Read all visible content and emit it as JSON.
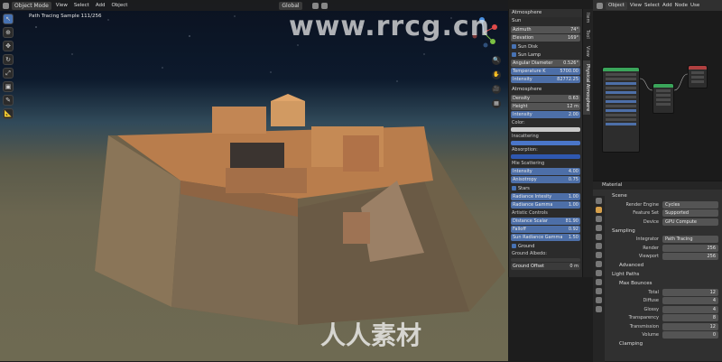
{
  "viewport": {
    "mode": "Object Mode",
    "menus": [
      "View",
      "Select",
      "Add",
      "Object"
    ],
    "orientation": "Global",
    "status": "Path Tracing Sample 111/256",
    "watermark": "www.rrcg.cn",
    "watermark_logo": "人人素材"
  },
  "atmosphere": {
    "title": "Atmosphere",
    "sun_section": "Sun",
    "azimuth_label": "Azimuth",
    "azimuth_value": "74°",
    "elevation_label": "Elevation",
    "elevation_value": "169°",
    "sun_disk": "Sun Disk",
    "sun_lamp": "Sun Lamp",
    "angular_label": "Angular Diameter",
    "angular_value": "0.526°",
    "temp_label": "Temperature K",
    "temp_value": "5700.00",
    "intensity_label": "Intensity",
    "intensity_value": "82772.25",
    "atmo_section": "Atmosphere",
    "density_label": "Density",
    "density_value": "0.63",
    "height_label": "Height",
    "height_value": "12 m",
    "a_intensity_label": "Intensity",
    "a_intensity_value": "2.00",
    "color_label": "Color:",
    "inscattering_label": "Inscattering",
    "absorption_label": "Absorption:",
    "mie_label": "Mie Scattering",
    "mie_intensity_label": "Intensity",
    "mie_intensity_value": "4.00",
    "anisotropy_label": "Anisotropy",
    "anisotropy_value": "0.75",
    "stars_section": "Stars",
    "rad_int_label": "Radiance Intesity",
    "rad_int_value": "1.00",
    "rad_gamma_label": "Radiance Gamma",
    "rad_gamma_value": "1.00",
    "artistic_label": "Artistic Controls",
    "dist_scalar_label": "Distance Scalar",
    "dist_scalar_value": "81.90",
    "falloff_label": "Falloff",
    "falloff_value": "0.92",
    "sun_rad_gamma_label": "Sun Radiance Gamma",
    "sun_rad_gamma_value": "1.50",
    "ground_section": "Ground",
    "ground_albedo_label": "Ground Albedo:",
    "ground_offset_label": "Ground Offset",
    "ground_offset_value": "0 m"
  },
  "side_tabs": [
    "Item",
    "Tool",
    "View",
    "Physical Atmosphere"
  ],
  "node_header": {
    "mode": "Object",
    "menus": [
      "View",
      "Select",
      "Add",
      "Node",
      "Use"
    ]
  },
  "properties": {
    "material_label": "Material",
    "scene_label": "Scene",
    "render_engine_label": "Render Engine",
    "render_engine_value": "Cycles",
    "feature_set_label": "Feature Set",
    "feature_set_value": "Supported",
    "device_label": "Device",
    "device_value": "GPU Compute",
    "sampling_label": "Sampling",
    "integrator_label": "Integrator",
    "integrator_value": "Path Tracing",
    "render_label": "Render",
    "render_value": "256",
    "viewport_label": "Viewport",
    "viewport_value": "256",
    "advanced_label": "Advanced",
    "light_paths_label": "Light Paths",
    "max_bounces_label": "Max Bounces",
    "total_label": "Total",
    "total_value": "12",
    "diffuse_label": "Diffuse",
    "diffuse_value": "4",
    "glossy_label": "Glossy",
    "glossy_value": "4",
    "transparency_label": "Transparency",
    "transparency_value": "8",
    "transmission_label": "Transmission",
    "transmission_value": "12",
    "volume_label": "Volume",
    "volume_value": "0",
    "clamping_label": "Clamping"
  }
}
